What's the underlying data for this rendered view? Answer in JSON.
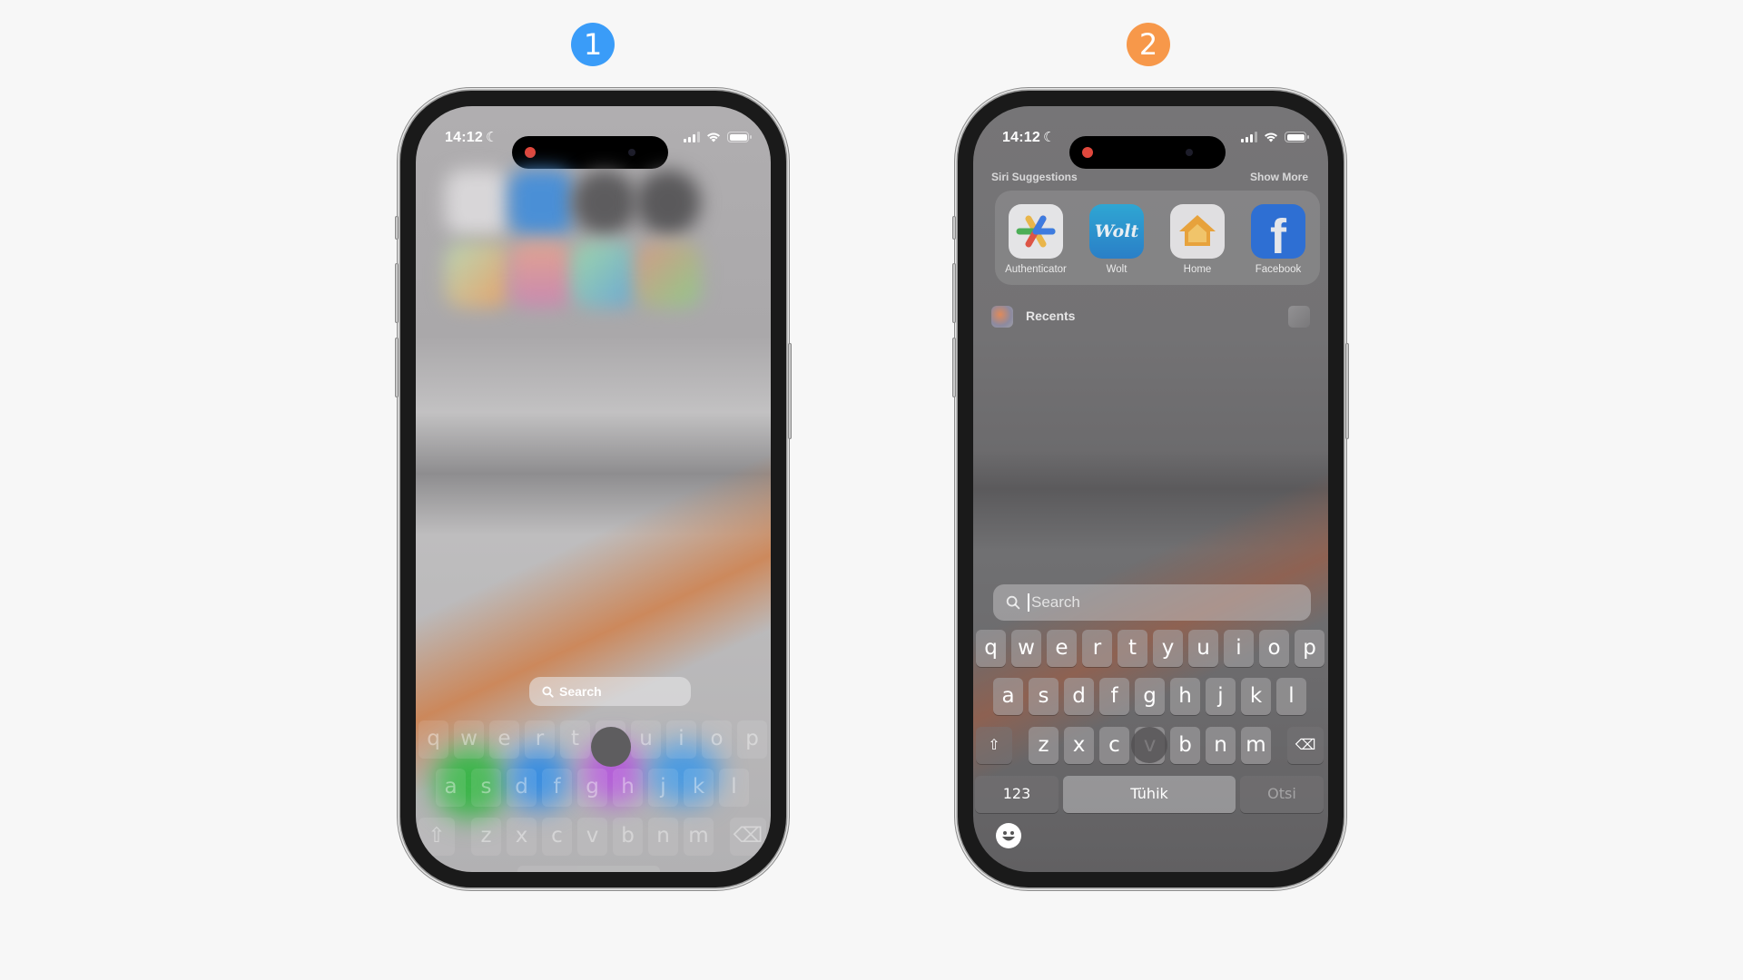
{
  "badges": [
    {
      "label": "1",
      "color": "#3a9cf8"
    },
    {
      "label": "2",
      "color": "#f7984a"
    }
  ],
  "phone1": {
    "status": {
      "time": "14:12",
      "moon": "☾"
    },
    "search_pill": {
      "label": "Search",
      "icon": "search-icon"
    },
    "keyboard": {
      "row1": [
        "q",
        "w",
        "e",
        "r",
        "t",
        "y",
        "u",
        "i",
        "o",
        "p"
      ],
      "row2": [
        "a",
        "s",
        "d",
        "f",
        "g",
        "h",
        "j",
        "k",
        "l"
      ],
      "row3": [
        "z",
        "x",
        "c",
        "v",
        "b",
        "n",
        "m"
      ],
      "shift_icon": "⇧",
      "delete_icon": "⌫"
    }
  },
  "phone2": {
    "status": {
      "time": "14:12",
      "moon": "☾"
    },
    "siri_suggestions": {
      "title": "Siri Suggestions",
      "show_more": "Show More",
      "apps": [
        {
          "name": "Authenticator",
          "icon": "authenticator-icon"
        },
        {
          "name": "Wolt",
          "icon": "wolt-icon",
          "glyph": "Wolt"
        },
        {
          "name": "Home",
          "icon": "home-icon"
        },
        {
          "name": "Facebook",
          "icon": "facebook-icon",
          "glyph": "f"
        }
      ]
    },
    "recents": {
      "label": "Recents"
    },
    "search": {
      "placeholder": "Search"
    },
    "keyboard": {
      "row1": [
        "q",
        "w",
        "e",
        "r",
        "t",
        "y",
        "u",
        "i",
        "o",
        "p"
      ],
      "row2": [
        "a",
        "s",
        "d",
        "f",
        "g",
        "h",
        "j",
        "k",
        "l"
      ],
      "row3": [
        "z",
        "x",
        "c",
        "v",
        "b",
        "n",
        "m"
      ],
      "shift_icon": "⇧",
      "delete_icon": "⌫",
      "numbers_label": "123",
      "space_label": "Tühik",
      "search_label": "Otsi"
    }
  }
}
